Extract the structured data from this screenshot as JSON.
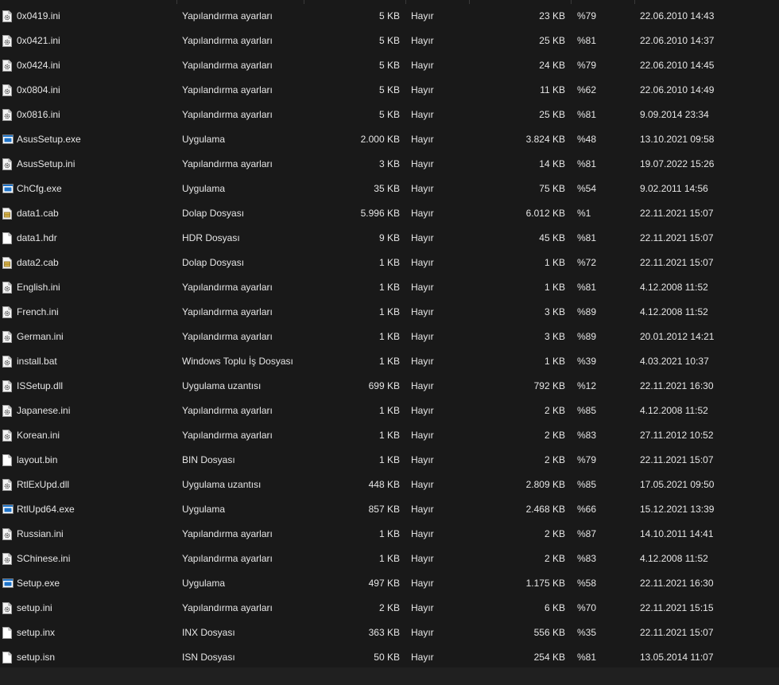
{
  "files": [
    {
      "name": "0x0419.ini",
      "type": "Yapılandırma ayarları",
      "size": "5 KB",
      "packed": "Hayır",
      "orig_size": "23 KB",
      "ratio": "%79",
      "date": "22.06.2010 14:43",
      "icon": "settings-file-icon"
    },
    {
      "name": "0x0421.ini",
      "type": "Yapılandırma ayarları",
      "size": "5 KB",
      "packed": "Hayır",
      "orig_size": "25 KB",
      "ratio": "%81",
      "date": "22.06.2010 14:37",
      "icon": "settings-file-icon"
    },
    {
      "name": "0x0424.ini",
      "type": "Yapılandırma ayarları",
      "size": "5 KB",
      "packed": "Hayır",
      "orig_size": "24 KB",
      "ratio": "%79",
      "date": "22.06.2010 14:45",
      "icon": "settings-file-icon"
    },
    {
      "name": "0x0804.ini",
      "type": "Yapılandırma ayarları",
      "size": "5 KB",
      "packed": "Hayır",
      "orig_size": "11 KB",
      "ratio": "%62",
      "date": "22.06.2010 14:49",
      "icon": "settings-file-icon"
    },
    {
      "name": "0x0816.ini",
      "type": "Yapılandırma ayarları",
      "size": "5 KB",
      "packed": "Hayır",
      "orig_size": "25 KB",
      "ratio": "%81",
      "date": "9.09.2014 23:34",
      "icon": "settings-file-icon"
    },
    {
      "name": "AsusSetup.exe",
      "type": "Uygulama",
      "size": "2.000 KB",
      "packed": "Hayır",
      "orig_size": "3.824 KB",
      "ratio": "%48",
      "date": "13.10.2021 09:58",
      "icon": "application-icon"
    },
    {
      "name": "AsusSetup.ini",
      "type": "Yapılandırma ayarları",
      "size": "3 KB",
      "packed": "Hayır",
      "orig_size": "14 KB",
      "ratio": "%81",
      "date": "19.07.2022 15:26",
      "icon": "settings-file-icon"
    },
    {
      "name": "ChCfg.exe",
      "type": "Uygulama",
      "size": "35 KB",
      "packed": "Hayır",
      "orig_size": "75 KB",
      "ratio": "%54",
      "date": "9.02.2011 14:56",
      "icon": "application-icon"
    },
    {
      "name": "data1.cab",
      "type": "Dolap Dosyası",
      "size": "5.996 KB",
      "packed": "Hayır",
      "orig_size": "6.012 KB",
      "ratio": "%1",
      "date": "22.11.2021 15:07",
      "icon": "cabinet-file-icon"
    },
    {
      "name": "data1.hdr",
      "type": "HDR Dosyası",
      "size": "9 KB",
      "packed": "Hayır",
      "orig_size": "45 KB",
      "ratio": "%81",
      "date": "22.11.2021 15:07",
      "icon": "blank-file-icon"
    },
    {
      "name": "data2.cab",
      "type": "Dolap Dosyası",
      "size": "1 KB",
      "packed": "Hayır",
      "orig_size": "1 KB",
      "ratio": "%72",
      "date": "22.11.2021 15:07",
      "icon": "cabinet-file-icon"
    },
    {
      "name": "English.ini",
      "type": "Yapılandırma ayarları",
      "size": "1 KB",
      "packed": "Hayır",
      "orig_size": "1 KB",
      "ratio": "%81",
      "date": "4.12.2008 11:52",
      "icon": "settings-file-icon"
    },
    {
      "name": "French.ini",
      "type": "Yapılandırma ayarları",
      "size": "1 KB",
      "packed": "Hayır",
      "orig_size": "3 KB",
      "ratio": "%89",
      "date": "4.12.2008 11:52",
      "icon": "settings-file-icon"
    },
    {
      "name": "German.ini",
      "type": "Yapılandırma ayarları",
      "size": "1 KB",
      "packed": "Hayır",
      "orig_size": "3 KB",
      "ratio": "%89",
      "date": "20.01.2012 14:21",
      "icon": "settings-file-icon"
    },
    {
      "name": "install.bat",
      "type": "Windows Toplu İş Dosyası",
      "size": "1 KB",
      "packed": "Hayır",
      "orig_size": "1 KB",
      "ratio": "%39",
      "date": "4.03.2021 10:37",
      "icon": "settings-file-icon"
    },
    {
      "name": "ISSetup.dll",
      "type": "Uygulama uzantısı",
      "size": "699 KB",
      "packed": "Hayır",
      "orig_size": "792 KB",
      "ratio": "%12",
      "date": "22.11.2021 16:30",
      "icon": "settings-file-icon"
    },
    {
      "name": "Japanese.ini",
      "type": "Yapılandırma ayarları",
      "size": "1 KB",
      "packed": "Hayır",
      "orig_size": "2 KB",
      "ratio": "%85",
      "date": "4.12.2008 11:52",
      "icon": "settings-file-icon"
    },
    {
      "name": "Korean.ini",
      "type": "Yapılandırma ayarları",
      "size": "1 KB",
      "packed": "Hayır",
      "orig_size": "2 KB",
      "ratio": "%83",
      "date": "27.11.2012 10:52",
      "icon": "settings-file-icon"
    },
    {
      "name": "layout.bin",
      "type": "BIN Dosyası",
      "size": "1 KB",
      "packed": "Hayır",
      "orig_size": "2 KB",
      "ratio": "%79",
      "date": "22.11.2021 15:07",
      "icon": "blank-file-icon"
    },
    {
      "name": "RtlExUpd.dll",
      "type": "Uygulama uzantısı",
      "size": "448 KB",
      "packed": "Hayır",
      "orig_size": "2.809 KB",
      "ratio": "%85",
      "date": "17.05.2021 09:50",
      "icon": "settings-file-icon"
    },
    {
      "name": "RtlUpd64.exe",
      "type": "Uygulama",
      "size": "857 KB",
      "packed": "Hayır",
      "orig_size": "2.468 KB",
      "ratio": "%66",
      "date": "15.12.2021 13:39",
      "icon": "application-icon"
    },
    {
      "name": "Russian.ini",
      "type": "Yapılandırma ayarları",
      "size": "1 KB",
      "packed": "Hayır",
      "orig_size": "2 KB",
      "ratio": "%87",
      "date": "14.10.2011 14:41",
      "icon": "settings-file-icon"
    },
    {
      "name": "SChinese.ini",
      "type": "Yapılandırma ayarları",
      "size": "1 KB",
      "packed": "Hayır",
      "orig_size": "2 KB",
      "ratio": "%83",
      "date": "4.12.2008 11:52",
      "icon": "settings-file-icon"
    },
    {
      "name": "Setup.exe",
      "type": "Uygulama",
      "size": "497 KB",
      "packed": "Hayır",
      "orig_size": "1.175 KB",
      "ratio": "%58",
      "date": "22.11.2021 16:30",
      "icon": "application-icon"
    },
    {
      "name": "setup.ini",
      "type": "Yapılandırma ayarları",
      "size": "2 KB",
      "packed": "Hayır",
      "orig_size": "6 KB",
      "ratio": "%70",
      "date": "22.11.2021 15:15",
      "icon": "settings-file-icon"
    },
    {
      "name": "setup.inx",
      "type": "INX Dosyası",
      "size": "363 KB",
      "packed": "Hayır",
      "orig_size": "556 KB",
      "ratio": "%35",
      "date": "22.11.2021 15:07",
      "icon": "blank-file-icon"
    },
    {
      "name": "setup.isn",
      "type": "ISN Dosyası",
      "size": "50 KB",
      "packed": "Hayır",
      "orig_size": "254 KB",
      "ratio": "%81",
      "date": "13.05.2014 11:07",
      "icon": "blank-file-icon"
    }
  ],
  "colors": {
    "background": "#191919",
    "text": "#e6e6e6",
    "separator": "#3a3a3a",
    "app_icon_blue": "#1e73c8"
  }
}
